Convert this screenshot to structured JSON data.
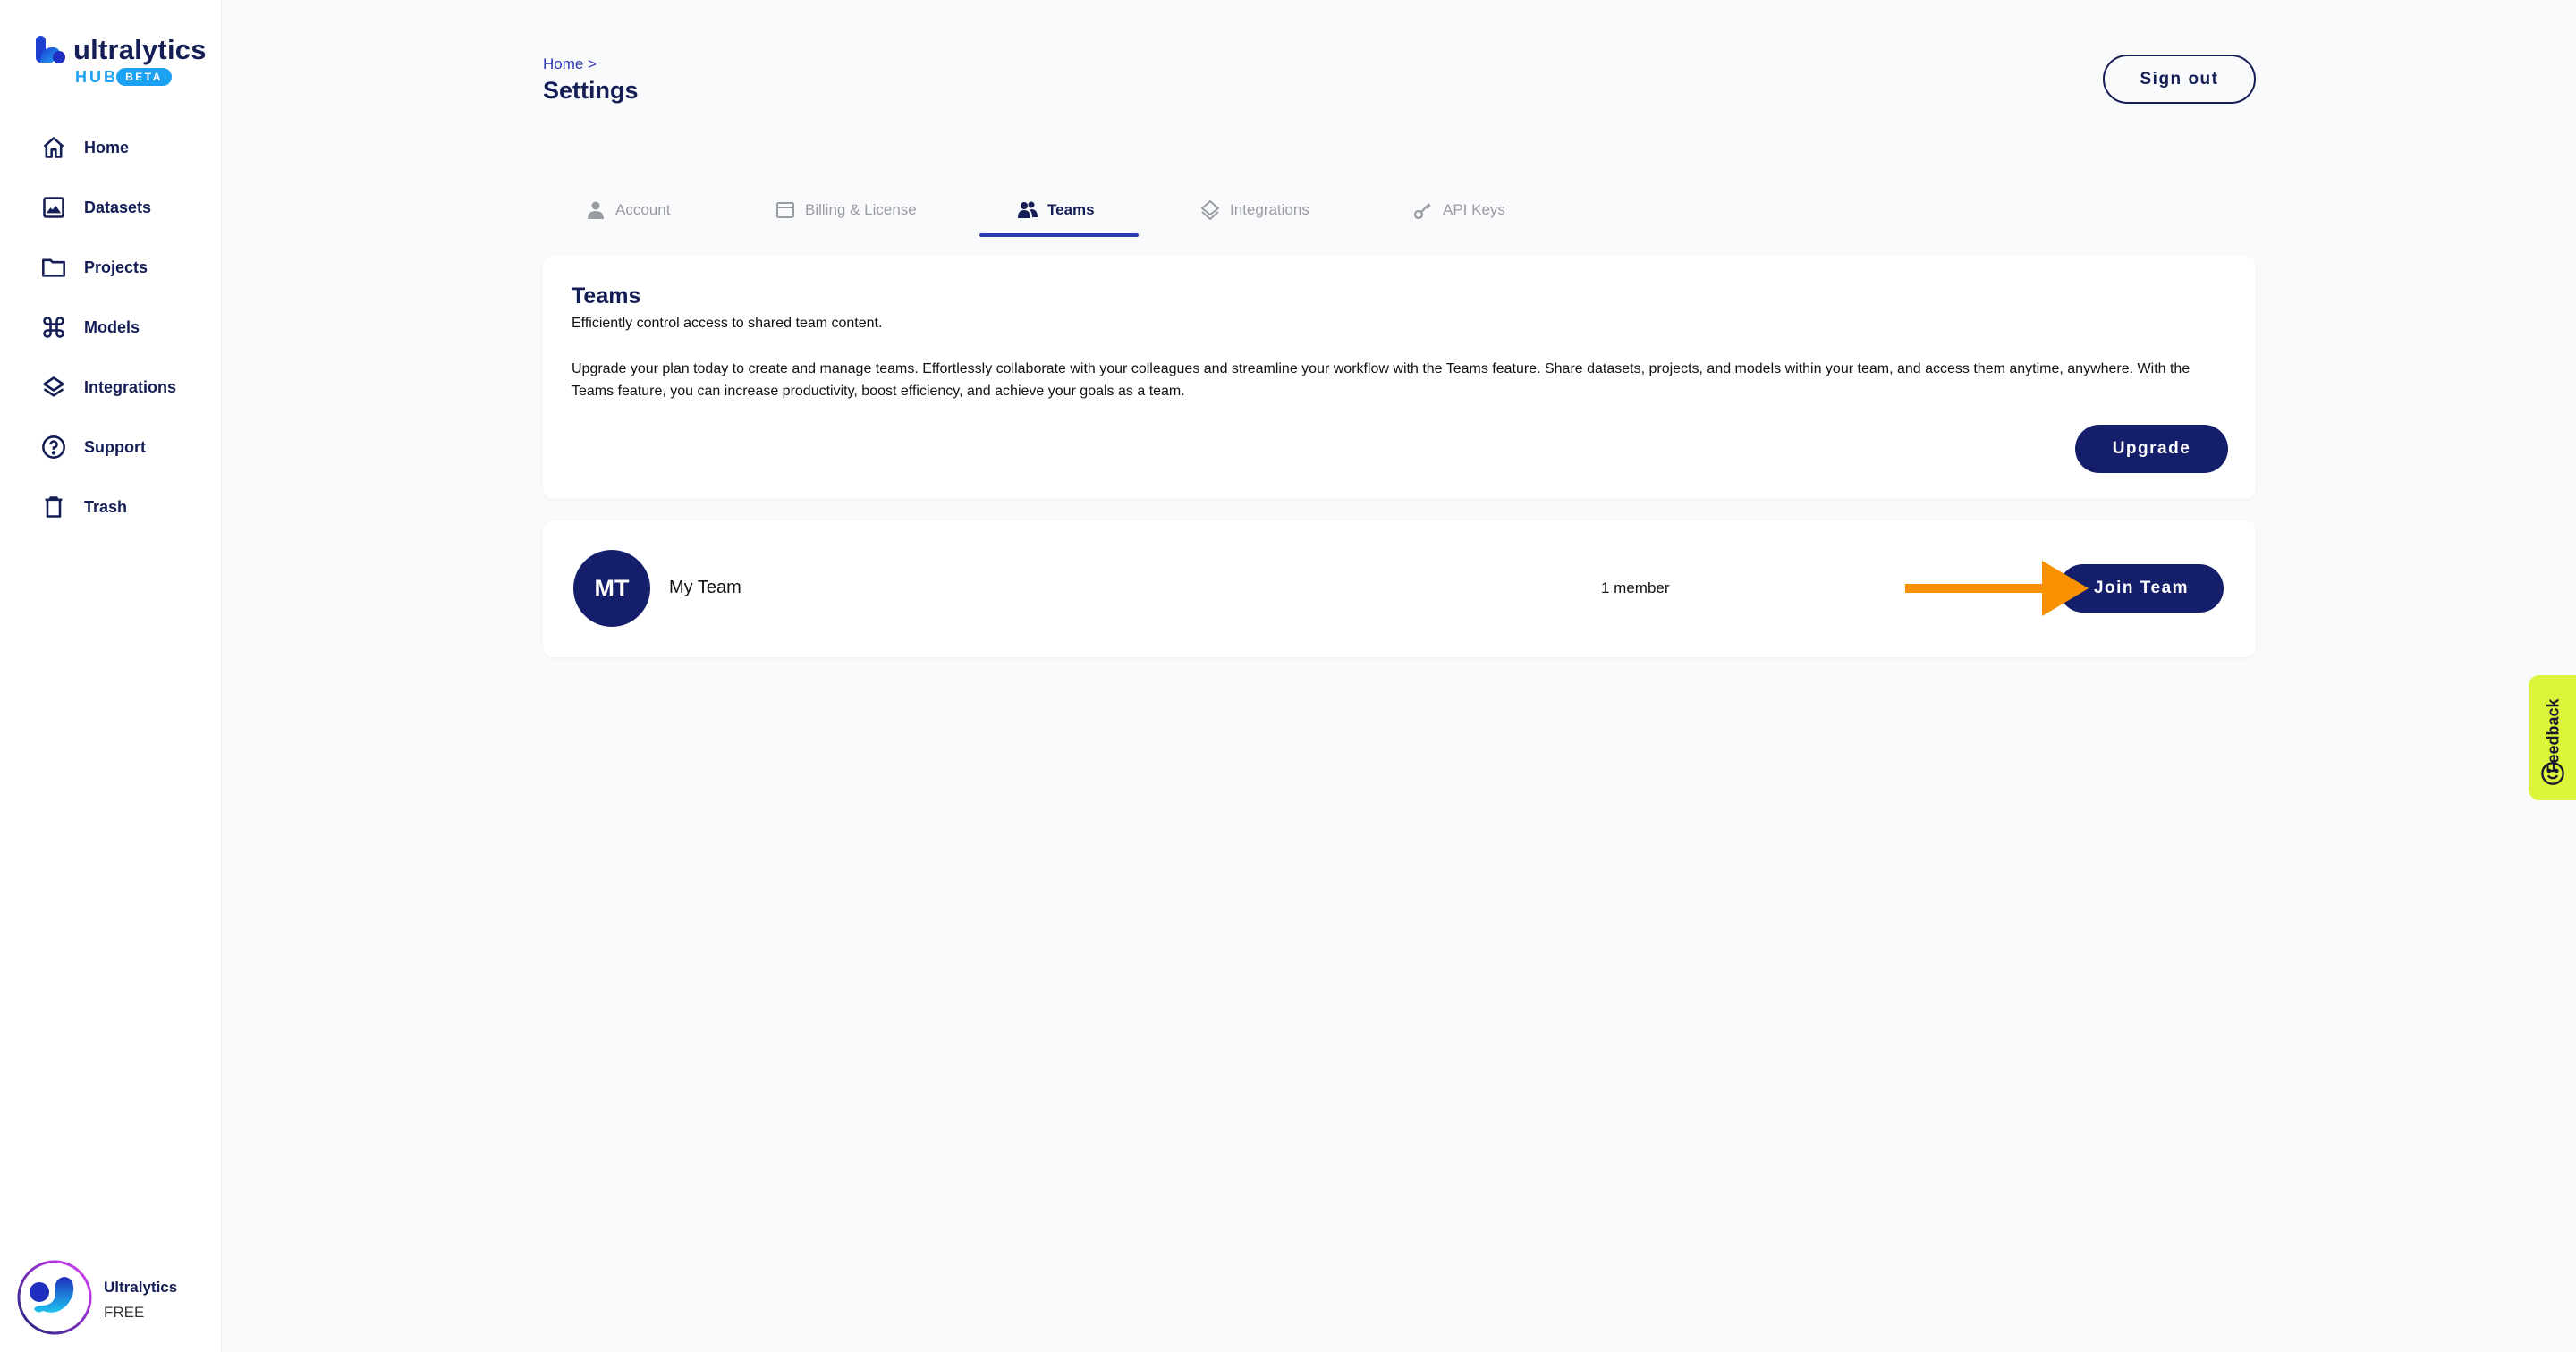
{
  "brand": {
    "name": "ultralytics",
    "product": "HUB",
    "badge": "BETA"
  },
  "sidebar": {
    "items": [
      {
        "label": "Home",
        "icon": "home-icon"
      },
      {
        "label": "Datasets",
        "icon": "image-icon"
      },
      {
        "label": "Projects",
        "icon": "folder-icon"
      },
      {
        "label": "Models",
        "icon": "command-icon"
      },
      {
        "label": "Integrations",
        "icon": "layers-icon"
      },
      {
        "label": "Support",
        "icon": "help-circle-icon"
      },
      {
        "label": "Trash",
        "icon": "trash-icon"
      }
    ],
    "user": {
      "name": "Ultralytics",
      "plan": "FREE"
    }
  },
  "header": {
    "breadcrumb": "Home >",
    "title": "Settings",
    "sign_out_label": "Sign out"
  },
  "tabs": [
    {
      "label": "Account",
      "icon": "user-icon",
      "active": false
    },
    {
      "label": "Billing & License",
      "icon": "credit-card-icon",
      "active": false
    },
    {
      "label": "Teams",
      "icon": "users-icon",
      "active": true
    },
    {
      "label": "Integrations",
      "icon": "layers-icon",
      "active": false
    },
    {
      "label": "API Keys",
      "icon": "key-icon",
      "active": false
    }
  ],
  "teams_card": {
    "title": "Teams",
    "subtitle": "Efficiently control access to shared team content.",
    "body": "Upgrade your plan today to create and manage teams. Effortlessly collaborate with your colleagues and streamline your workflow with the Teams feature. Share datasets, projects, and models within your team, and access them anytime, anywhere. With the Teams feature, you can increase productivity, boost efficiency, and achieve your goals as a team.",
    "upgrade_label": "Upgrade"
  },
  "team": {
    "initials": "MT",
    "name": "My Team",
    "members": "1 member",
    "join_label": "Join Team"
  },
  "feedback": {
    "label": "Feedback"
  },
  "colors": {
    "primary": "#141e6a",
    "accent_blue": "#1da1f2",
    "link": "#2a3ab0",
    "feedback_bg": "#dcf53a",
    "annotation_arrow": "#fa9200"
  }
}
